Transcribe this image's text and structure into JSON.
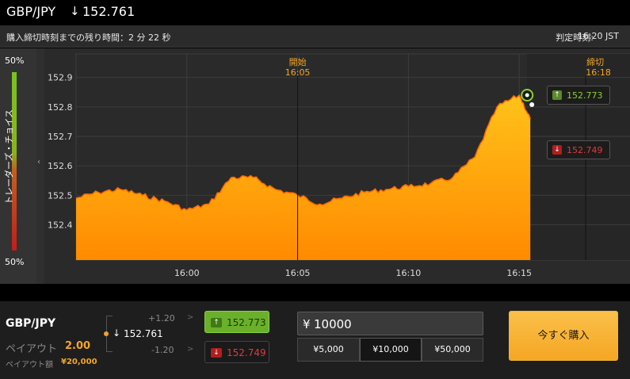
{
  "header": {
    "pair": "GBP/JPY",
    "direction_icon": "arrow-down-icon",
    "rate": "152.761"
  },
  "infobar": {
    "remaining_text": "購入締切時刻までの残り時間：2 分 22 秒",
    "judge_label": "判定時刻:",
    "judge_time": "16:20 JST"
  },
  "sentiment": {
    "top_pct": "50%",
    "bottom_pct": "50%",
    "label": "トレーダーズ・チョイス",
    "buy_share": 0.5
  },
  "chart_markers": {
    "start_label": "開始",
    "start_time": "16:05",
    "end_label": "締切",
    "end_time": "16:18"
  },
  "quotes": {
    "high": "152.773",
    "low": "152.749"
  },
  "colors": {
    "accent_orange": "#f5a623",
    "up_green": "#8bd22a",
    "down_red": "#e23a3a",
    "fill_orange": "#ff8c00"
  },
  "chart_data": {
    "type": "area",
    "title": "",
    "xlabel": "",
    "ylabel": "",
    "x_tick_labels": [
      "16:00",
      "16:05",
      "16:10",
      "16:15"
    ],
    "y_tick_labels": [
      "152.9",
      "152.8",
      "152.7",
      "152.6",
      "152.5",
      "152.4"
    ],
    "xlim": [
      "15:55",
      "16:20"
    ],
    "ylim": [
      152.28,
      152.98
    ],
    "grid": true,
    "x": [
      "15:55",
      "15:56",
      "15:57",
      "15:58",
      "15:59",
      "16:00",
      "16:01",
      "16:02",
      "16:03",
      "16:04",
      "16:05",
      "16:06",
      "16:07",
      "16:08",
      "16:09",
      "16:10",
      "16:11",
      "16:12",
      "16:13",
      "16:14",
      "16:15",
      "16:15:30"
    ],
    "values": [
      152.49,
      152.51,
      152.52,
      152.5,
      152.48,
      152.45,
      152.47,
      152.56,
      152.56,
      152.52,
      152.5,
      152.47,
      152.49,
      152.51,
      152.52,
      152.53,
      152.54,
      152.56,
      152.63,
      152.8,
      152.84,
      152.76
    ]
  },
  "panel": {
    "pair": "GBP/JPY",
    "payout_label": "ペイアウト",
    "payout_value": "2.00",
    "payout_amount_label": "ペイアウト額",
    "payout_amount": "¥20,000",
    "spot_direction_icon": "arrow-down-icon",
    "spot_rate": "152.761",
    "delta_up": "+1.20",
    "delta_down": "-1.20",
    "chevron": ">",
    "high_button": "152.773",
    "low_button": "152.749",
    "currency": "¥",
    "amount": "10000",
    "presets": [
      "¥5,000",
      "¥10,000",
      "¥50,000"
    ],
    "selected_preset": "¥10,000",
    "buy_label": "今すぐ購入"
  }
}
